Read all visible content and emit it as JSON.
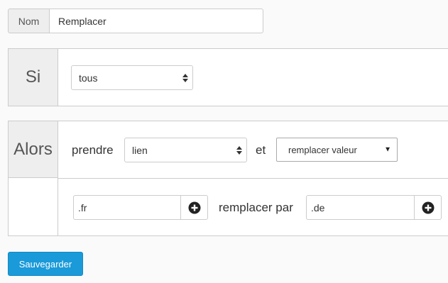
{
  "name_field": {
    "label": "Nom",
    "value": "Remplacer"
  },
  "condition": {
    "label": "Si",
    "select_value": "tous"
  },
  "action": {
    "label": "Alors",
    "take_label": "prendre",
    "take_select_value": "lien",
    "and_label": "et",
    "operation_select_value": "remplacer valeur",
    "search_value": ".fr",
    "replace_label": "remplacer par",
    "replace_value": ".de"
  },
  "save_button": {
    "label": "Sauvegarder"
  },
  "colors": {
    "primary": "#1a9ad9",
    "addon_bg": "#eeeeee",
    "border": "#cccccc"
  },
  "icons": {
    "updown": "sort-arrows-icon",
    "caret": "caret-down-icon",
    "add": "plus-circle-icon"
  }
}
